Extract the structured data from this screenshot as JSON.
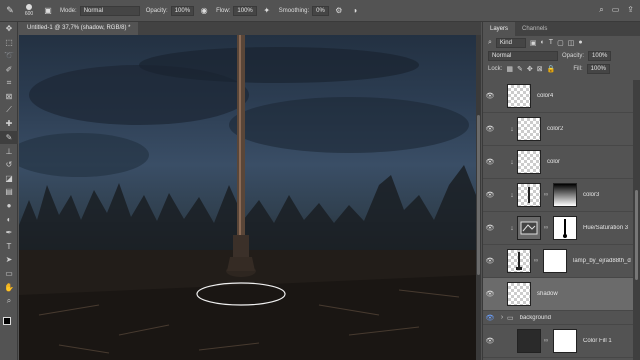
{
  "options_bar": {
    "tool_icon": "brush-icon",
    "brush_size": "600",
    "mode_label": "Mode:",
    "mode_value": "Normal",
    "opacity_label": "Opacity:",
    "opacity_value": "100%",
    "flow_label": "Flow:",
    "flow_value": "100%",
    "smoothing_label": "Smoothing:",
    "smoothing_value": "0%"
  },
  "document": {
    "tab_title": "Untitled-1 @ 37,7% (shadow, RGB/8) *"
  },
  "panel": {
    "tabs": [
      "Layers",
      "Channels"
    ],
    "filter_kind": "Kind",
    "blend_mode": "Normal",
    "opacity_label": "Opacity:",
    "opacity_value": "100%",
    "lock_label": "Lock:",
    "fill_label": "Fill:",
    "fill_value": "100%"
  },
  "layers": [
    {
      "name": "color4",
      "visible": true,
      "clipped": false,
      "thumb": "transparent",
      "mask": false
    },
    {
      "name": "color2",
      "visible": true,
      "clipped": true,
      "thumb": "transparent",
      "mask": false
    },
    {
      "name": "color",
      "visible": true,
      "clipped": true,
      "thumb": "transparent",
      "mask": false
    },
    {
      "name": "color3",
      "visible": true,
      "clipped": true,
      "thumb": "transparent",
      "mask": true
    },
    {
      "name": "Hue/Saturation 3",
      "visible": true,
      "clipped": true,
      "thumb": "adjustment",
      "mask": true
    },
    {
      "name": "lamp_by_ejrad88th_d",
      "visible": true,
      "clipped": false,
      "thumb": "lamp",
      "mask": true
    },
    {
      "name": "shadow",
      "visible": true,
      "clipped": false,
      "thumb": "transparent",
      "mask": false,
      "selected": true
    },
    {
      "name": "background",
      "visible": true,
      "clipped": false,
      "group": true
    },
    {
      "name": "Color Fill 1",
      "visible": true,
      "clipped": false,
      "thumb": "fill",
      "mask": true
    }
  ],
  "colors": {
    "ui_bg": "#535353",
    "selected_layer": "#6b6b6b",
    "foreground": "#000000",
    "background": "#ffffff"
  }
}
